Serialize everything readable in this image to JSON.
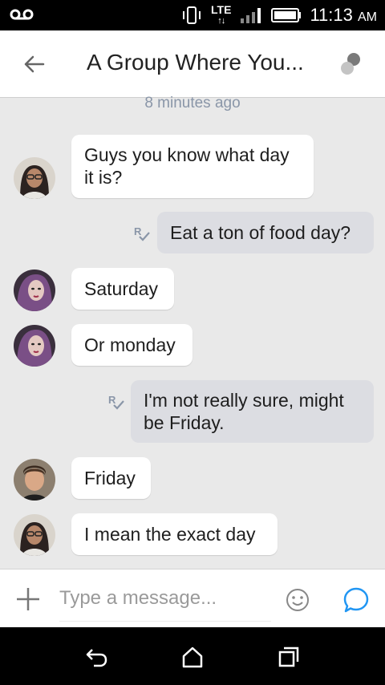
{
  "status_bar": {
    "network": "LTE",
    "time": "11:13",
    "ampm": "AM"
  },
  "header": {
    "title": "A Group Where You...",
    "back_icon": "arrow-left-icon",
    "menu_icon": "participants-icon"
  },
  "conversation": {
    "timestamp": "8 minutes ago",
    "messages": [
      {
        "direction": "incoming",
        "text1": "Guys you know what day",
        "text2": "it is?"
      },
      {
        "direction": "outgoing",
        "text": "Eat a ton of food day?"
      },
      {
        "direction": "incoming",
        "text": "Saturday"
      },
      {
        "direction": "incoming",
        "text": "Or monday"
      },
      {
        "direction": "outgoing",
        "text1": "I'm not really sure, might",
        "text2": "be Friday."
      },
      {
        "direction": "incoming",
        "text": "Friday"
      },
      {
        "direction": "incoming",
        "text": "I mean the exact day"
      }
    ]
  },
  "composer": {
    "placeholder": "Type a message...",
    "add_icon": "plus-icon",
    "emoji_icon": "smiley-icon",
    "send_icon": "chat-bubble-icon"
  },
  "colors": {
    "accent": "#2196f3",
    "background": "#e9e9e9",
    "incoming_bubble": "#ffffff",
    "outgoing_bubble": "#dcdde2",
    "timestamp": "#8a96a8"
  }
}
